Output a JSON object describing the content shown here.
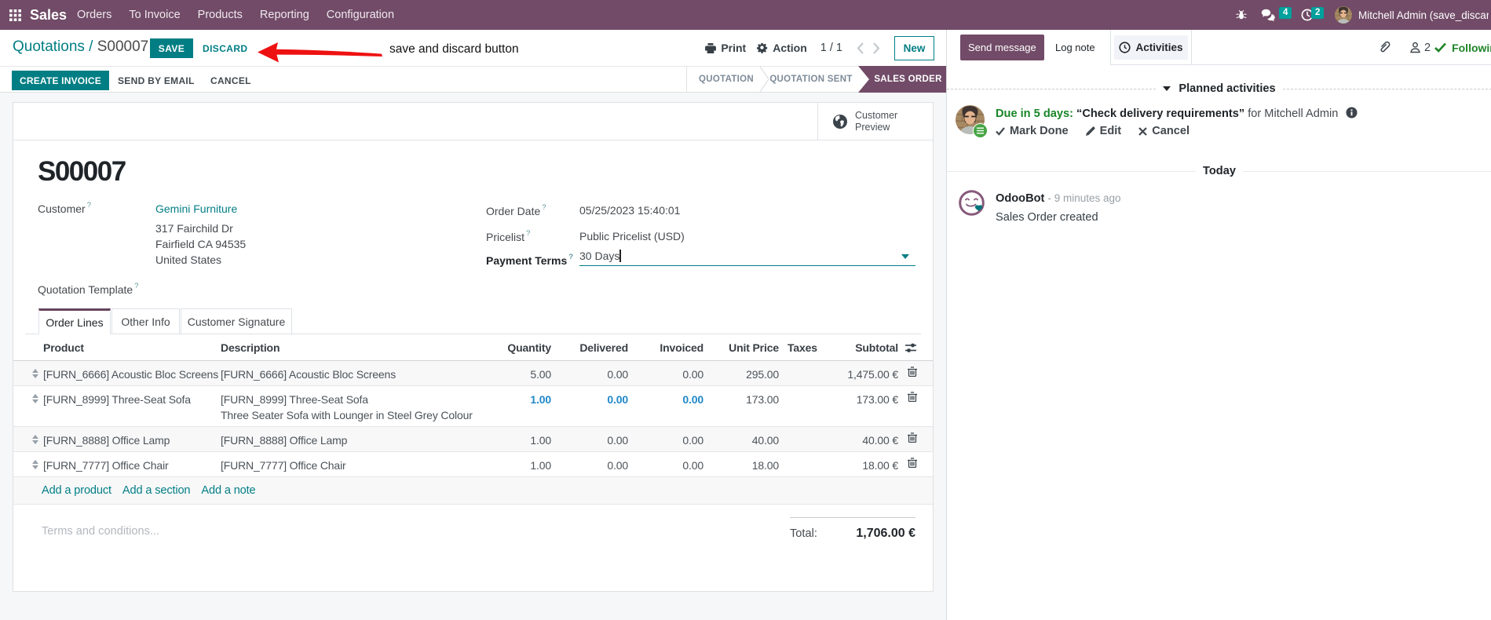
{
  "navbar": {
    "app_name": "Sales",
    "menus": [
      "Orders",
      "To Invoice",
      "Products",
      "Reporting",
      "Configuration"
    ],
    "messages_badge": "4",
    "activities_badge": "2",
    "user_name": "Mitchell Admin (save_discard"
  },
  "control_panel": {
    "breadcrumb_parent": "Quotations / ",
    "breadcrumb_current": "S00007",
    "save_label": "SAVE",
    "discard_label": "DISCARD",
    "annotation": "save and discard button",
    "print_label": "Print",
    "action_label": "Action",
    "pager": "1 / 1",
    "new_label": "New"
  },
  "statusbar": {
    "create_invoice": "CREATE INVOICE",
    "send_by_email": "SEND BY EMAIL",
    "cancel": "CANCEL",
    "stages": [
      "QUOTATION",
      "QUOTATION SENT",
      "SALES ORDER"
    ]
  },
  "sheet": {
    "customer_preview_line1": "Customer",
    "customer_preview_line2": "Preview",
    "title": "S00007",
    "help_marker": "?",
    "fields": {
      "customer_label": "Customer",
      "customer_value": "Gemini Furniture",
      "address_line1": "317 Fairchild Dr",
      "address_line2": "Fairfield CA 94535",
      "address_line3": "United States",
      "quotation_template_label": "Quotation Template",
      "order_date_label": "Order Date",
      "order_date_value": "05/25/2023 15:40:01",
      "pricelist_label": "Pricelist",
      "pricelist_value": "Public Pricelist (USD)",
      "payment_terms_label": "Payment Terms",
      "payment_terms_value": "30 Days"
    },
    "tabs": [
      "Order Lines",
      "Other Info",
      "Customer Signature"
    ],
    "order_lines": {
      "columns": [
        "Product",
        "Description",
        "Quantity",
        "Delivered",
        "Invoiced",
        "Unit Price",
        "Taxes",
        "Subtotal"
      ],
      "rows": [
        {
          "product": "[FURN_6666] Acoustic Bloc Screens",
          "description": "[FURN_6666] Acoustic Bloc Screens",
          "description2": "",
          "quantity": "5.00",
          "delivered": "0.00",
          "invoiced": "0.00",
          "unit_price": "295.00",
          "taxes": "",
          "subtotal": "1,475.00 €"
        },
        {
          "product": "[FURN_8999] Three-Seat Sofa",
          "description": "[FURN_8999] Three-Seat Sofa",
          "description2": "Three Seater Sofa with Lounger in Steel Grey Colour",
          "quantity": "1.00",
          "delivered": "0.00",
          "invoiced": "0.00",
          "unit_price": "173.00",
          "taxes": "",
          "subtotal": "173.00 €",
          "modified": true
        },
        {
          "product": "[FURN_8888] Office Lamp",
          "description": "[FURN_8888] Office Lamp",
          "description2": "",
          "quantity": "1.00",
          "delivered": "0.00",
          "invoiced": "0.00",
          "unit_price": "40.00",
          "taxes": "",
          "subtotal": "40.00 €"
        },
        {
          "product": "[FURN_7777] Office Chair",
          "description": "[FURN_7777] Office Chair",
          "description2": "",
          "quantity": "1.00",
          "delivered": "0.00",
          "invoiced": "0.00",
          "unit_price": "18.00",
          "taxes": "",
          "subtotal": "18.00 €"
        }
      ],
      "add_product": "Add a product",
      "add_section": "Add a section",
      "add_note": "Add a note"
    },
    "terms_placeholder": "Terms and conditions...",
    "total_label": "Total:",
    "total_value": "1,706.00 €"
  },
  "chatter": {
    "send_message": "Send message",
    "log_note": "Log note",
    "activities": "Activities",
    "followers_count": "2",
    "following": "Following",
    "planned_header": "Planned activities",
    "activity": {
      "due": "Due in 5 days:",
      "summary": "“Check delivery requirements”",
      "for_user": "for Mitchell Admin",
      "mark_done": "Mark Done",
      "edit": "Edit",
      "cancel": "Cancel"
    },
    "today": "Today",
    "message": {
      "author": "OdooBot",
      "time": "- 9 minutes ago",
      "body": "Sales Order created"
    }
  },
  "colors": {
    "brand": "#714B67",
    "accent": "#017e84",
    "badge": "#00A09D",
    "modified_cell": "#2088c9",
    "success": "#188527"
  }
}
